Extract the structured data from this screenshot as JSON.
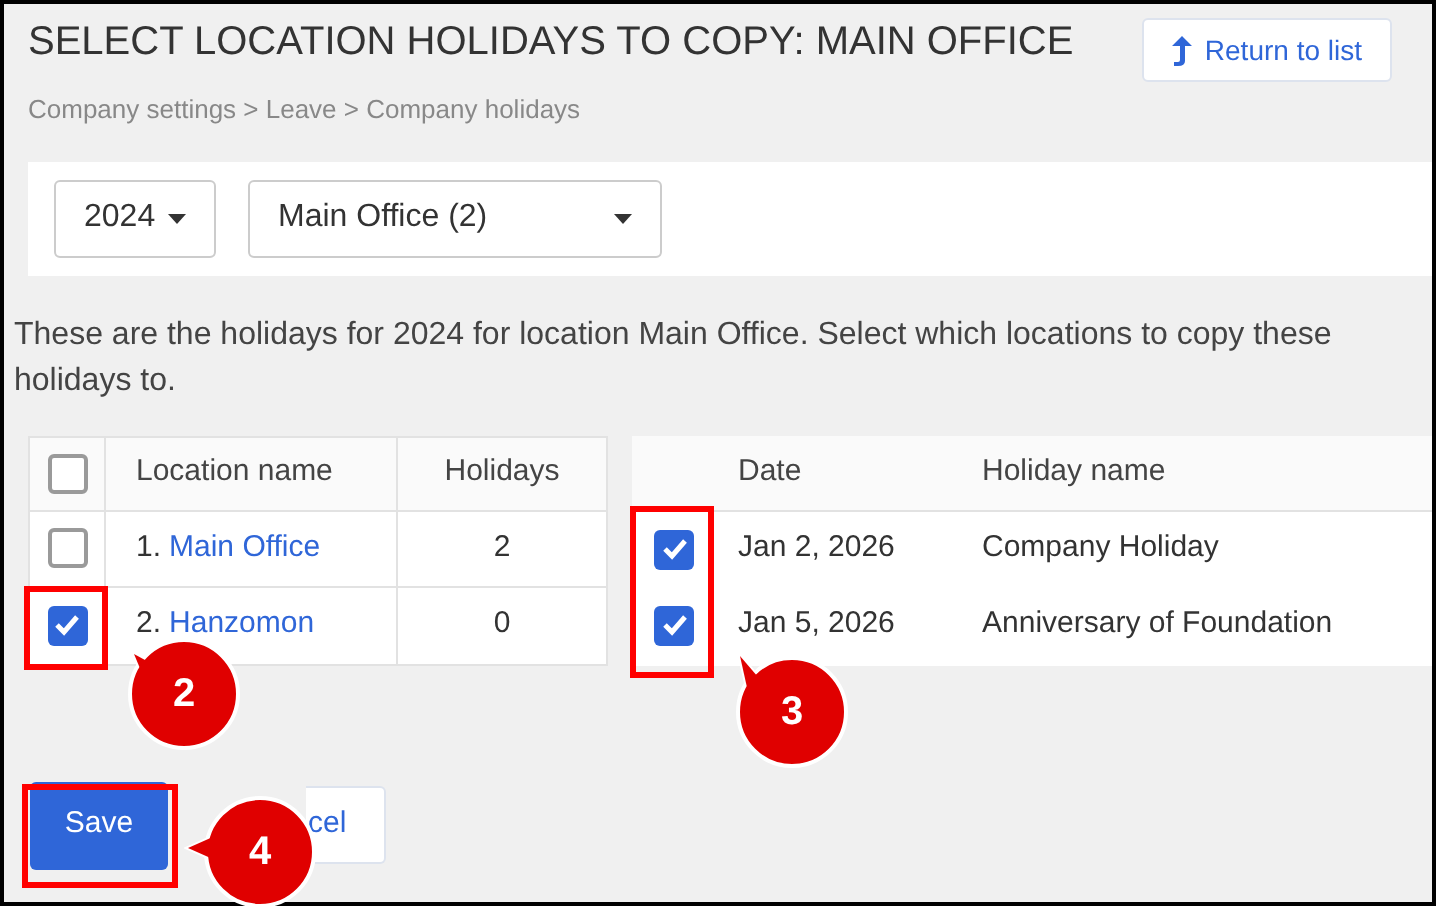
{
  "title": "SELECT LOCATION HOLIDAYS TO COPY: MAIN OFFICE",
  "return_button": {
    "label": "Return to list"
  },
  "breadcrumb": "Company settings > Leave > Company holidays",
  "filters": [
    {
      "value": "2024"
    },
    {
      "value": "Main Office (2)"
    }
  ],
  "description": "These are the holidays for 2024 for location Main Office. Select which locations to copy these holidays to.",
  "locations_table": {
    "select_all": {
      "checked": false
    },
    "columns": [
      "Location name",
      "Holidays"
    ],
    "rows": [
      {
        "index": "1.",
        "name": "Main Office",
        "holidays": "2",
        "checked": false
      },
      {
        "index": "2.",
        "name": "Hanzomon",
        "holidays": "0",
        "checked": true
      }
    ]
  },
  "holidays_table": {
    "columns": [
      "Date",
      "Holiday name"
    ],
    "rows": [
      {
        "date": "Jan 2, 2026",
        "name": "Company Holiday",
        "checked": true
      },
      {
        "date": "Jan 5, 2026",
        "name": "Anniversary of Foundation",
        "checked": true
      }
    ]
  },
  "buttons": [
    {
      "kind": "primary",
      "label": "Save"
    },
    {
      "kind": "secondary",
      "label": "cel"
    }
  ],
  "callouts": [
    {
      "label": "2"
    },
    {
      "label": "3"
    },
    {
      "label": "4"
    }
  ]
}
